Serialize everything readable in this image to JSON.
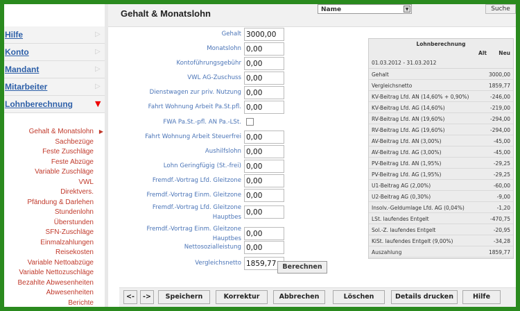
{
  "sidebar": {
    "nav": [
      {
        "label": "Hilfe"
      },
      {
        "label": "Konto"
      },
      {
        "label": "Mandant"
      },
      {
        "label": "Mitarbeiter"
      },
      {
        "label": "Lohnberechnung"
      }
    ],
    "sub": [
      "Gehalt & Monatslohn",
      "Sachbezüge",
      "Feste Zuschläge",
      "Feste Abzüge",
      "Variable Zuschläge",
      "VWL",
      "Direktvers.",
      "Pfändung & Darlehen",
      "Stundenlohn",
      "Überstunden",
      "SFN-Zuschläge",
      "Einmalzahlungen",
      "Reisekosten",
      "Variable Nettoabzüge",
      "Variable Nettozuschläge",
      "Bezahlte Abwesenheiten",
      "Abwesenheiten",
      "Berichte"
    ]
  },
  "header": {
    "title": "Gehalt & Monatslohn",
    "name_select": "Name",
    "search_label": "Suche"
  },
  "form": [
    {
      "label": "Gehalt",
      "value": "3000,00"
    },
    {
      "label": "Monatslohn",
      "value": "0,00"
    },
    {
      "label": "Kontoführungsgebühr",
      "value": "0,00"
    },
    {
      "label": "VWL AG-Zuschuss",
      "value": "0,00"
    },
    {
      "label": "Dienstwagen zur priv. Nutzung",
      "value": "0,00"
    },
    {
      "label": "Fahrt Wohnung Arbeit Pa.St.pfl.",
      "value": "0,00"
    },
    {
      "label": "FWA Pa.St.-pfl. AN Pa.-LSt.",
      "value": ""
    },
    {
      "label": "Fahrt Wohnung Arbeit Steuerfrei",
      "value": "0,00"
    },
    {
      "label": "Aushilfslohn",
      "value": "0,00"
    },
    {
      "label": "Lohn Geringfügig (St.-frei)",
      "value": "0,00"
    },
    {
      "label": "Fremdf.-Vortrag Lfd. Gleitzone",
      "value": "0,00"
    },
    {
      "label": "Fremdf.-Vortrag Einm. Gleitzone",
      "value": "0,00"
    },
    {
      "label": "Fremdf.-Vortrag Lfd. Gleitzone",
      "label2": "Hauptbes",
      "value": "0,00"
    },
    {
      "label": "Fremdf.-Vortrag Einm. Gleitzone",
      "label2": "Hauptbes",
      "value": "0,00"
    },
    {
      "label": "Nettosozialleistung",
      "value": "0,00"
    },
    {
      "label": "Vergleichsnetto",
      "value": "1859,77"
    }
  ],
  "calculate_label": "Berechnen",
  "lohn": {
    "title": "Lohnberechnung",
    "col_alt": "Alt",
    "col_neu": "Neu",
    "period": "01.03.2012 - 31.03.2012",
    "rows": [
      {
        "k": "Gehalt",
        "v": "3000,00"
      },
      {
        "k": "Vergleichsnetto",
        "v": "1859,77"
      },
      {
        "k": "KV-Beitrag Lfd. AN (14,60% + 0,90%)",
        "v": "-246,00"
      },
      {
        "k": "KV-Beitrag Lfd. AG (14,60%)",
        "v": "-219,00"
      },
      {
        "k": "RV-Beitrag Lfd. AN (19,60%)",
        "v": "-294,00"
      },
      {
        "k": "RV-Beitrag Lfd. AG (19,60%)",
        "v": "-294,00"
      },
      {
        "k": "AV-Beitrag Lfd. AN (3,00%)",
        "v": "-45,00"
      },
      {
        "k": "AV-Beitrag Lfd. AG (3,00%)",
        "v": "-45,00"
      },
      {
        "k": "PV-Beitrag Lfd. AN (1,95%)",
        "v": "-29,25"
      },
      {
        "k": "PV-Beitrag Lfd. AG (1,95%)",
        "v": "-29,25"
      },
      {
        "k": "U1-Beitrag AG (2,00%)",
        "v": "-60,00"
      },
      {
        "k": "U2-Beitrag AG (0,30%)",
        "v": "-9,00"
      },
      {
        "k": "Insolv.-Geldumlage Lfd. AG (0,04%)",
        "v": "-1,20"
      },
      {
        "k": "LSt. laufendes Entgelt",
        "v": "-470,75"
      },
      {
        "k": "Sol.-Z. laufendes Entgelt",
        "v": "-20,95"
      },
      {
        "k": "KiSt. laufendes Entgelt (9,00%)",
        "v": "-34,28"
      },
      {
        "k": "Auszahlung",
        "v": "1859,77"
      }
    ]
  },
  "footer": {
    "prev": "<-",
    "next": "->",
    "buttons": [
      "Speichern",
      "Korrektur",
      "Abbrechen",
      "Löschen",
      "Details drucken",
      "Hilfe"
    ]
  }
}
